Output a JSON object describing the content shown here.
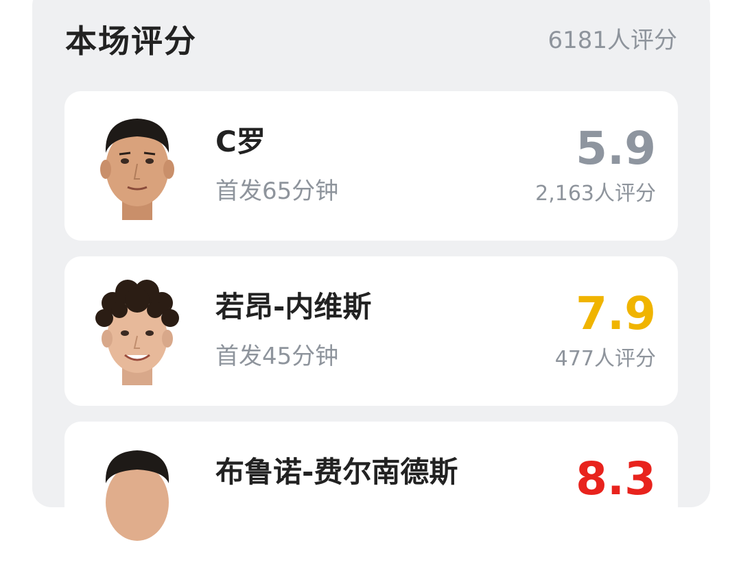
{
  "header": {
    "title": "本场评分",
    "total_raters": "6181人评分"
  },
  "players": [
    {
      "name": "C罗",
      "subtitle": "首发65分钟",
      "score": "5.9",
      "score_color": "#8e959f",
      "raters": "2,163人评分"
    },
    {
      "name": "若昂-内维斯",
      "subtitle": "首发45分钟",
      "score": "7.9",
      "score_color": "#f0b400",
      "raters": "477人评分"
    },
    {
      "name": "布鲁诺-费尔南德斯",
      "subtitle": "",
      "score": "8.3",
      "score_color": "#e8231d",
      "raters": ""
    }
  ]
}
